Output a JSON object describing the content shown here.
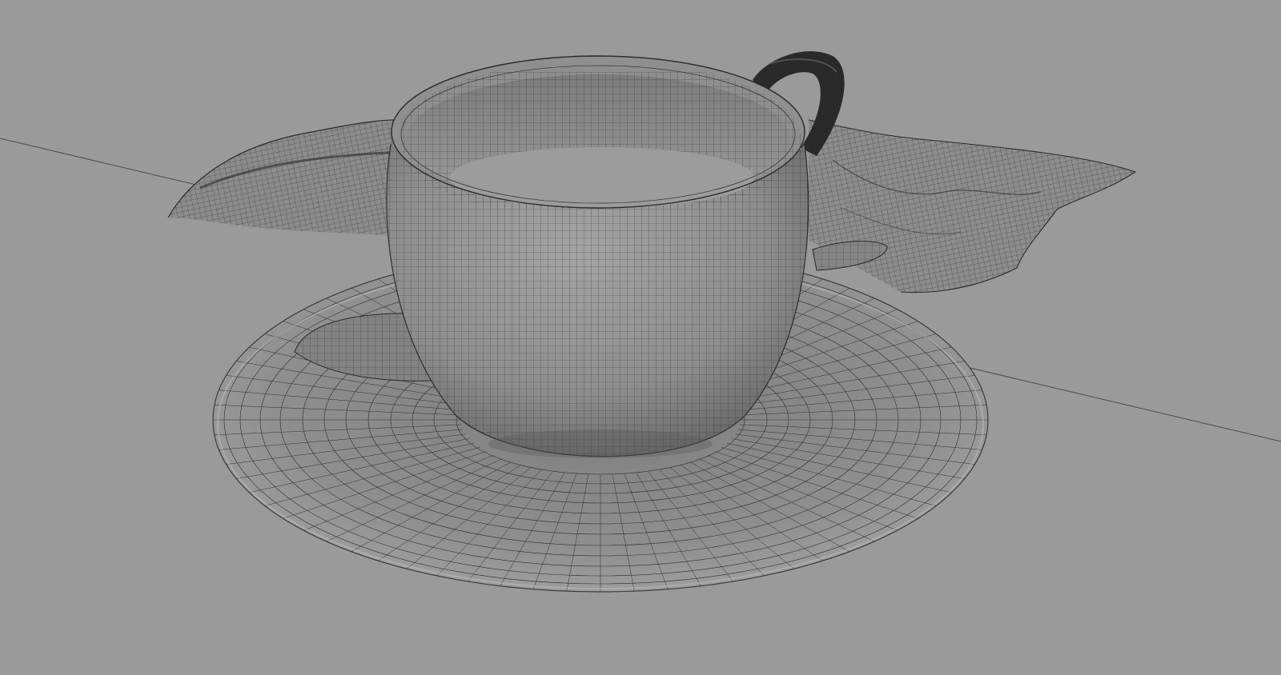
{
  "viewport": {
    "background_color": "#9a9a9a",
    "shading": "wireframe-on-shaded",
    "objects": [
      {
        "name": "cup",
        "mesh_color": "#8e8e8e",
        "wire_color": "#2a2a2a"
      },
      {
        "name": "cup-handle",
        "mesh_color": "#2b2b2b",
        "wire_color": "#111111"
      },
      {
        "name": "saucer",
        "mesh_color": "#8d8d8d",
        "wire_color": "#2e2e2e"
      },
      {
        "name": "spoon",
        "mesh_color": "#838383",
        "wire_color": "#2a2a2a"
      },
      {
        "name": "cloth",
        "mesh_color": "#8c8c8c",
        "wire_color": "#2d2d2d"
      }
    ],
    "axis_line_color": "#4a4a4a"
  }
}
